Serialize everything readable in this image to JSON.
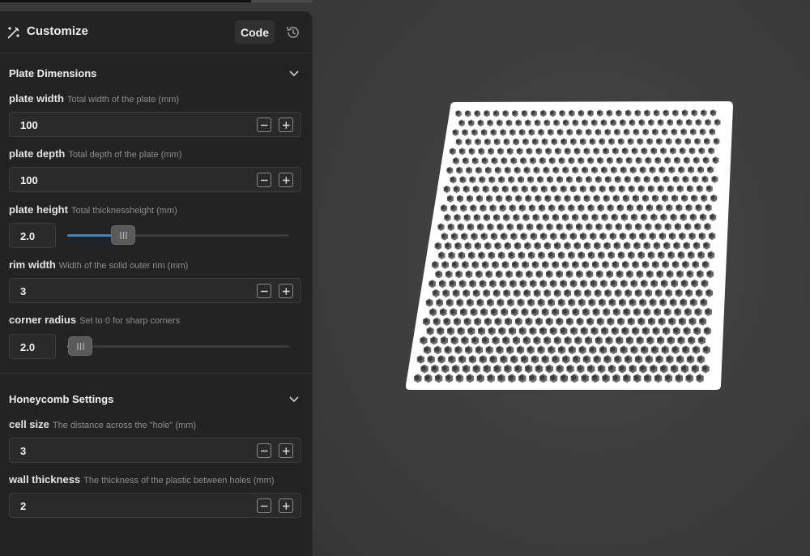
{
  "header": {
    "title": "Customize",
    "code_label": "Code",
    "brand_icon": "wand-customize-icon",
    "history_icon": "history-icon"
  },
  "sections": [
    {
      "title": "Plate Dimensions",
      "expanded": true,
      "params": [
        {
          "name": "plate width",
          "description": "Total width of the plate (mm)",
          "value": "100",
          "control": "number"
        },
        {
          "name": "plate depth",
          "description": "Total depth of the plate (mm)",
          "value": "100",
          "control": "number"
        },
        {
          "name": "plate height",
          "description": "Total thicknessheight (mm)",
          "value": "2.0",
          "control": "slider",
          "slider_level": 0.25
        },
        {
          "name": "rim width",
          "description": "Width of the solid outer rim (mm)",
          "value": "3",
          "control": "number"
        },
        {
          "name": "corner radius",
          "description": "Set to 0 for sharp corners",
          "value": "2.0",
          "control": "slider",
          "slider_level": 0.06
        }
      ]
    },
    {
      "title": "Honeycomb Settings",
      "expanded": true,
      "params": [
        {
          "name": "cell size",
          "description": "The distance across the \"hole\" (mm)",
          "value": "3",
          "control": "number"
        },
        {
          "name": "wall thickness",
          "description": "The thickness of the plastic between holes (mm)",
          "value": "2",
          "control": "number"
        }
      ]
    }
  ],
  "colors": {
    "panel_bg": "#232323",
    "viewport_bg": "#3d3d3d",
    "accent": "#1e8fe6",
    "plate": "#ffffff",
    "hole_shadow": "#6a6a6a"
  }
}
